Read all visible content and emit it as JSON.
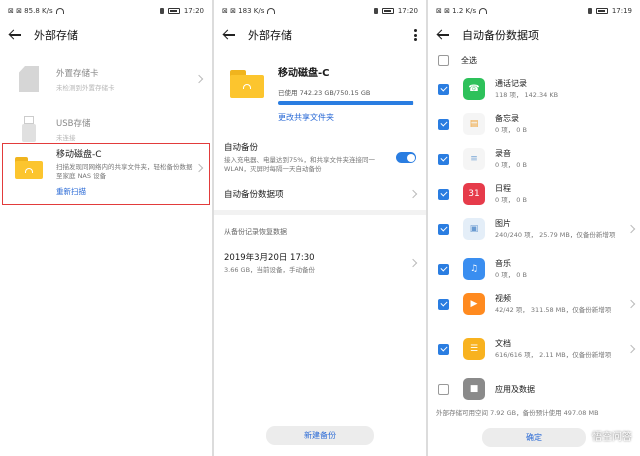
{
  "screen1": {
    "status": {
      "left": "⊠ ⊠ 85.8 K/s",
      "time": "17:20"
    },
    "title": "外部存储",
    "items": [
      {
        "name": "外置存储卡",
        "sub": "未检测到外置存储卡"
      },
      {
        "name": "USB存储",
        "sub": "未连接"
      }
    ],
    "disk": {
      "name": "移动磁盘-C",
      "sub": "扫描发现同网络内的共享文件夹，轻松备份数据至家庭 NAS 设备",
      "rescan": "重新扫描"
    }
  },
  "screen2": {
    "status": {
      "left": "⊠ ⊠ 183 K/s",
      "time": "17:20"
    },
    "title": "外部存储",
    "disk_name": "移动磁盘-C",
    "used_label": "已使用 742.23 GB/750.15 GB",
    "used_fraction": 0.989,
    "change_folder": "更改共享文件夹",
    "auto_backup": {
      "title": "自动备份",
      "desc": "接入充电器、电量达到75%，和共享文件夹连接同一 WLAN，灭屏时每隔一天自动备份",
      "enabled": true
    },
    "auto_items": "自动备份数据项",
    "restore_label": "从备份记录恢复数据",
    "record": {
      "date": "2019年3月20日 17:30",
      "detail": "3.66 GB，当前设备，手动备份"
    },
    "new_backup": "新建备份"
  },
  "screen3": {
    "status": {
      "left": "⊠ ⊠ 1.2 K/s",
      "time": "17:19"
    },
    "title": "自动备份数据项",
    "select_all": "全选",
    "items": [
      {
        "name": "通话记录",
        "size": "118 项，  142.34 KB",
        "checked": true,
        "icon": "phone-icon",
        "color": "#2dc15a",
        "arrow": false
      },
      {
        "name": "备忘录",
        "size": "0 项，  0 B",
        "checked": true,
        "icon": "notes-icon",
        "color": "#f5f5f5",
        "arrow": false
      },
      {
        "name": "录音",
        "size": "0 项，  0 B",
        "checked": true,
        "icon": "recorder-icon",
        "color": "#f5f5f5",
        "arrow": false
      },
      {
        "name": "日程",
        "size": "0 项，  0 B",
        "checked": true,
        "icon": "calendar-icon",
        "color": "#e63b4a",
        "arrow": false,
        "badge": "31"
      },
      {
        "name": "图片",
        "size": "240/240 项，  25.79 MB，仅备份新增项",
        "checked": true,
        "icon": "gallery-icon",
        "color": "#e4eef8",
        "arrow": true
      },
      {
        "name": "音乐",
        "size": "0 项，  0 B",
        "checked": true,
        "icon": "music-icon",
        "color": "#3a8ef0",
        "arrow": false
      },
      {
        "name": "视频",
        "size": "42/42 项，  311.58 MB，仅备份新增项",
        "checked": true,
        "icon": "video-icon",
        "color": "#ff8a1f",
        "arrow": true
      },
      {
        "name": "文档",
        "size": "616/616 项，  2.11 MB，仅备份新增项",
        "checked": true,
        "icon": "document-icon",
        "color": "#f8b21f",
        "arrow": true
      },
      {
        "name": "应用及数据",
        "size": "",
        "checked": false,
        "icon": "apps-icon",
        "color": "#8a8a8a",
        "arrow": false
      }
    ],
    "footer": "外部存储可用空间 7.92 GB，备份预计使用 497.08 MB",
    "confirm": "确定",
    "watermark": "悟空问答"
  }
}
